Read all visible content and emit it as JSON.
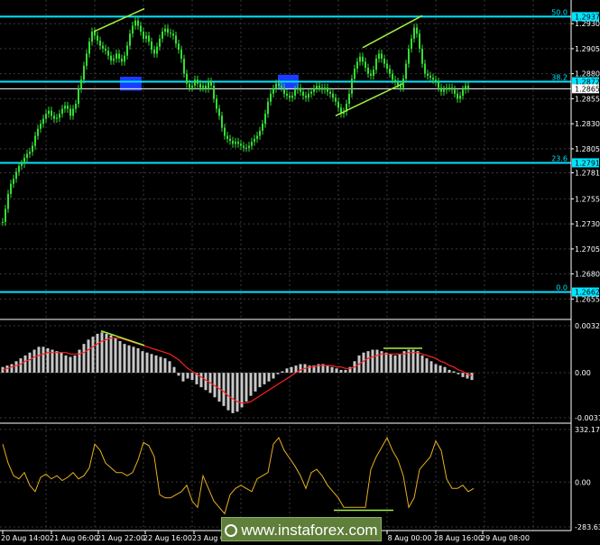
{
  "colors": {
    "background": "#000000",
    "grid": "#3a3a3a",
    "level": "#00e5ff",
    "price": "#33dd33",
    "pattern": "#a4f040",
    "zone": "#1a3cff",
    "histogram": "#c8c8c8",
    "signal": "#ff2020",
    "oscillator": "#e8b020",
    "axis_text": "#ffffff"
  },
  "chart_data": [
    {
      "type": "line",
      "panel": "price",
      "ylim": [
        1.264,
        1.295
      ],
      "yticks": [
        "1.2930",
        "1.2905",
        "1.2880",
        "1.2855",
        "1.2830",
        "1.2805",
        "1.2781",
        "1.2755",
        "1.2730",
        "1.2705",
        "1.2680",
        "1.2655"
      ],
      "ytick_values": [
        1.293,
        1.2905,
        1.288,
        1.2855,
        1.283,
        1.2805,
        1.2781,
        1.2755,
        1.273,
        1.2705,
        1.268,
        1.2655
      ],
      "grid": true,
      "levels": [
        {
          "label": "50.0",
          "value": 1.2937,
          "tag": "1.2937"
        },
        {
          "label": "38.2",
          "value": 1.2872,
          "tag": "1.2872"
        },
        {
          "label": "23.6",
          "value": 1.2791,
          "tag": "1.2791"
        },
        {
          "label": "0.0",
          "value": 1.2662,
          "tag": "1.2662"
        }
      ],
      "current_price": {
        "value": 1.2865,
        "tag": "1.2865"
      },
      "x": [
        0,
        3,
        6,
        9,
        12,
        15,
        18,
        21,
        24,
        27,
        30,
        33,
        36,
        39,
        42,
        45,
        48,
        51,
        54,
        57,
        60,
        63,
        66,
        69,
        72,
        75,
        78,
        81,
        84,
        87,
        90,
        93,
        96,
        99,
        102,
        105,
        108,
        111,
        114,
        117,
        120,
        123,
        126,
        129,
        132,
        135,
        138,
        141,
        144,
        147,
        150,
        153,
        156,
        159,
        162,
        165,
        168,
        171,
        174,
        177,
        180,
        183,
        186,
        189,
        192,
        195,
        198,
        201,
        204,
        207,
        210,
        213,
        216,
        219,
        222,
        225,
        228,
        231,
        234,
        237,
        240,
        243,
        246,
        249,
        252,
        255,
        258,
        261,
        264,
        267,
        270,
        273,
        276,
        279,
        282,
        285,
        288,
        291,
        294,
        297,
        300,
        303,
        306,
        309,
        312,
        315,
        318,
        321,
        324,
        327,
        330,
        333,
        336,
        339,
        342,
        345,
        348,
        351,
        354,
        357,
        360,
        363,
        366,
        369,
        372,
        375,
        378,
        381,
        384,
        387,
        390,
        393,
        396,
        399,
        402,
        405,
        408,
        411,
        414,
        417,
        420,
        423,
        426,
        429,
        432,
        435,
        438,
        441,
        444,
        447,
        450,
        453,
        456,
        459,
        462,
        465,
        468,
        471,
        474,
        477,
        480,
        483,
        486,
        489,
        492,
        495,
        498,
        501,
        504,
        507,
        510,
        513,
        516,
        519,
        522
      ],
      "series": [
        {
          "values": [
            1.2732,
            1.2745,
            1.276,
            1.277,
            1.2775,
            1.2782,
            1.2788,
            1.279,
            1.2796,
            1.28,
            1.2802,
            1.2808,
            1.2818,
            1.2825,
            1.283,
            1.2835,
            1.284,
            1.2843,
            1.2838,
            1.2835,
            1.2836,
            1.284,
            1.2845,
            1.2848,
            1.2845,
            1.2838,
            1.2845,
            1.285,
            1.2865,
            1.2874,
            1.2888,
            1.29,
            1.2912,
            1.2922,
            1.2918,
            1.2913,
            1.2908,
            1.2905,
            1.2903,
            1.2898,
            1.2893,
            1.2895,
            1.29,
            1.2895,
            1.2892,
            1.2898,
            1.2908,
            1.292,
            1.2928,
            1.2933,
            1.2928,
            1.2922,
            1.2915,
            1.2918,
            1.2912,
            1.2904,
            1.29,
            1.2907,
            1.2915,
            1.2922,
            1.2925,
            1.2921,
            1.292,
            1.2918,
            1.291,
            1.2904,
            1.2895,
            1.288,
            1.287,
            1.2866,
            1.2868,
            1.2874,
            1.287,
            1.2866,
            1.2868,
            1.2865,
            1.2872,
            1.2868,
            1.2855,
            1.2845,
            1.2838,
            1.2826,
            1.2818,
            1.2815,
            1.2813,
            1.281,
            1.2812,
            1.281,
            1.2808,
            1.2806,
            1.2806,
            1.2808,
            1.2812,
            1.2815,
            1.2818,
            1.2823,
            1.283,
            1.284,
            1.2852,
            1.286,
            1.2865,
            1.287,
            1.2868,
            1.2866,
            1.286,
            1.2858,
            1.2856,
            1.2858,
            1.2864,
            1.2866,
            1.2862,
            1.2858,
            1.2856,
            1.286,
            1.2862,
            1.2865,
            1.2868,
            1.2866,
            1.2864,
            1.2866,
            1.2862,
            1.286,
            1.2856,
            1.2852,
            1.2846,
            1.284,
            1.2842,
            1.285,
            1.286,
            1.2875,
            1.2885,
            1.2892,
            1.2897,
            1.2892,
            1.2886,
            1.288,
            1.2878,
            1.2884,
            1.2895,
            1.29,
            1.2895,
            1.289,
            1.2885,
            1.288,
            1.2874,
            1.2872,
            1.2868,
            1.2866,
            1.2875,
            1.289,
            1.2905,
            1.2915,
            1.2926,
            1.292,
            1.2905,
            1.289,
            1.288,
            1.2878,
            1.2876,
            1.2874,
            1.2872,
            1.2866,
            1.2862,
            1.2864,
            1.2866,
            1.2866,
            1.2864,
            1.286,
            1.2855,
            1.2858,
            1.2864,
            1.2868,
            1.2865
          ]
        }
      ]
    },
    {
      "type": "bar",
      "panel": "histogram",
      "ylim": [
        -0.00312,
        0.00326
      ],
      "yticks": [
        "0.00326",
        "0.00",
        "-0.00312"
      ],
      "ytick_values": [
        0.00326,
        0.0,
        -0.00312
      ],
      "x": [
        0,
        5,
        10,
        15,
        20,
        25,
        30,
        35,
        40,
        45,
        50,
        55,
        60,
        65,
        70,
        75,
        80,
        85,
        90,
        95,
        100,
        105,
        110,
        115,
        120,
        125,
        130,
        135,
        140,
        145,
        150,
        155,
        160,
        165,
        170,
        175,
        180,
        185,
        190,
        195,
        200,
        205,
        210,
        215,
        220,
        225,
        230,
        235,
        240,
        245,
        250,
        255,
        260,
        265,
        270,
        275,
        280,
        285,
        290,
        295,
        300,
        305,
        310,
        315,
        320,
        325,
        330,
        335,
        340,
        345,
        350,
        355,
        360,
        365,
        370,
        375,
        380,
        385,
        390,
        395,
        400,
        405,
        410,
        415,
        420,
        425,
        430,
        435,
        440,
        445,
        450,
        455,
        460,
        465,
        470,
        475,
        480,
        485,
        490,
        495,
        500,
        505,
        510,
        515,
        520
      ],
      "series": [
        {
          "values": [
            0.0004,
            0.0005,
            0.0006,
            0.0008,
            0.001,
            0.0012,
            0.0014,
            0.0016,
            0.0018,
            0.0018,
            0.0017,
            0.0016,
            0.0015,
            0.0014,
            0.0012,
            0.0011,
            0.0012,
            0.0016,
            0.002,
            0.0023,
            0.0025,
            0.0027,
            0.0028,
            0.0027,
            0.0026,
            0.0024,
            0.0022,
            0.002,
            0.0019,
            0.0018,
            0.0017,
            0.0015,
            0.0014,
            0.0013,
            0.0012,
            0.0011,
            0.001,
            0.0008,
            0.0004,
            -0.0002,
            -0.0006,
            -0.0004,
            -0.0005,
            -0.0008,
            -0.001,
            -0.0012,
            -0.0014,
            -0.0017,
            -0.002,
            -0.0023,
            -0.0026,
            -0.0028,
            -0.0027,
            -0.0024,
            -0.002,
            -0.0016,
            -0.0013,
            -0.001,
            -0.0008,
            -0.0006,
            -0.0004,
            -0.0001,
            0.0001,
            0.0003,
            0.0004,
            0.0005,
            0.0006,
            0.0006,
            0.0005,
            0.0005,
            0.0006,
            0.0006,
            0.0005,
            0.0004,
            0.0003,
            0.0002,
            0.0002,
            0.0004,
            0.0008,
            0.0012,
            0.0014,
            0.0015,
            0.0016,
            0.0016,
            0.0015,
            0.0014,
            0.0013,
            0.0012,
            0.0013,
            0.0015,
            0.0016,
            0.0016,
            0.0015,
            0.0012,
            0.001,
            0.0008,
            0.0006,
            0.0005,
            0.0004,
            0.0002,
            0.0001,
            -0.0001,
            -0.0003,
            -0.0004,
            -0.0005
          ]
        },
        {
          "values": [
            0.0002,
            0.0003,
            0.0004,
            0.0005,
            0.0006,
            0.0008,
            0.0009,
            0.0011,
            0.0012,
            0.0013,
            0.0014,
            0.0014,
            0.0014,
            0.0014,
            0.0014,
            0.0013,
            0.0013,
            0.0013,
            0.0014,
            0.0016,
            0.0018,
            0.002,
            0.0022,
            0.0023,
            0.0024,
            0.0024,
            0.0024,
            0.0023,
            0.0022,
            0.0021,
            0.002,
            0.0019,
            0.0018,
            0.0017,
            0.0016,
            0.0015,
            0.0014,
            0.0013,
            0.0011,
            0.0009,
            0.0006,
            0.0003,
            0.0001,
            -0.0001,
            -0.0003,
            -0.0005,
            -0.0007,
            -0.0009,
            -0.0011,
            -0.0013,
            -0.0016,
            -0.0018,
            -0.002,
            -0.0021,
            -0.0021,
            -0.002,
            -0.0018,
            -0.0016,
            -0.0014,
            -0.0012,
            -0.001,
            -0.0008,
            -0.0006,
            -0.0004,
            -0.0002,
            0.0,
            0.0002,
            0.0003,
            0.0004,
            0.0004,
            0.0005,
            0.0005,
            0.0005,
            0.0005,
            0.0004,
            0.0004,
            0.0003,
            0.0003,
            0.0004,
            0.0006,
            0.0008,
            0.001,
            0.0011,
            0.0012,
            0.0013,
            0.0013,
            0.0013,
            0.0013,
            0.0013,
            0.0013,
            0.0014,
            0.0014,
            0.0014,
            0.0013,
            0.0012,
            0.0011,
            0.001,
            0.0008,
            0.0007,
            0.0005,
            0.0004,
            0.0002,
            0.0001,
            -0.0001,
            -0.0002
          ]
        }
      ]
    },
    {
      "type": "line",
      "panel": "oscillator",
      "ylim": [
        -283.631,
        332.1719
      ],
      "yticks": [
        "332.1719",
        "0.00",
        "-283.631"
      ],
      "ytick_values": [
        332.1719,
        0.0,
        -283.631
      ],
      "x": [
        0,
        6,
        12,
        18,
        24,
        30,
        36,
        42,
        48,
        54,
        60,
        66,
        72,
        78,
        84,
        90,
        96,
        102,
        108,
        114,
        120,
        126,
        132,
        138,
        144,
        150,
        156,
        162,
        168,
        174,
        180,
        186,
        192,
        198,
        204,
        210,
        216,
        222,
        228,
        234,
        240,
        246,
        252,
        258,
        264,
        270,
        276,
        282,
        288,
        294,
        300,
        306,
        312,
        318,
        324,
        330,
        336,
        342,
        348,
        354,
        360,
        366,
        372,
        378,
        384,
        390,
        396,
        402,
        408,
        414,
        420,
        426,
        432,
        438,
        444,
        450,
        456,
        462,
        468,
        474,
        480,
        486,
        492,
        498,
        504,
        510,
        516,
        522
      ],
      "series": [
        {
          "values": [
            240,
            120,
            40,
            20,
            60,
            -20,
            -60,
            30,
            50,
            20,
            40,
            10,
            30,
            60,
            20,
            40,
            90,
            240,
            200,
            120,
            90,
            60,
            60,
            40,
            60,
            140,
            250,
            230,
            160,
            -80,
            -100,
            -100,
            -80,
            -60,
            -20,
            -120,
            -160,
            40,
            -40,
            -120,
            -160,
            -200,
            -80,
            -40,
            -20,
            -40,
            -60,
            20,
            40,
            60,
            240,
            280,
            200,
            150,
            100,
            40,
            -40,
            60,
            80,
            40,
            -20,
            -60,
            -100,
            -160,
            -160,
            -160,
            -160,
            -160,
            80,
            160,
            220,
            280,
            200,
            140,
            40,
            -160,
            -100,
            80,
            120,
            160,
            260,
            200,
            20,
            -40,
            -40,
            -20,
            -60,
            -40
          ]
        }
      ]
    }
  ],
  "x_axis": {
    "labels": [
      "20 Aug 14:00",
      "21 Aug 06:00",
      "21 Aug 22:00",
      "22 Aug 16:00",
      "23 Aug 08:00",
      "",
      "",
      "",
      "8 Aug 00:00",
      "28 Aug 16:00",
      "29 Aug 08:00"
    ]
  },
  "watermark": {
    "text": "www.instaforex.com"
  }
}
